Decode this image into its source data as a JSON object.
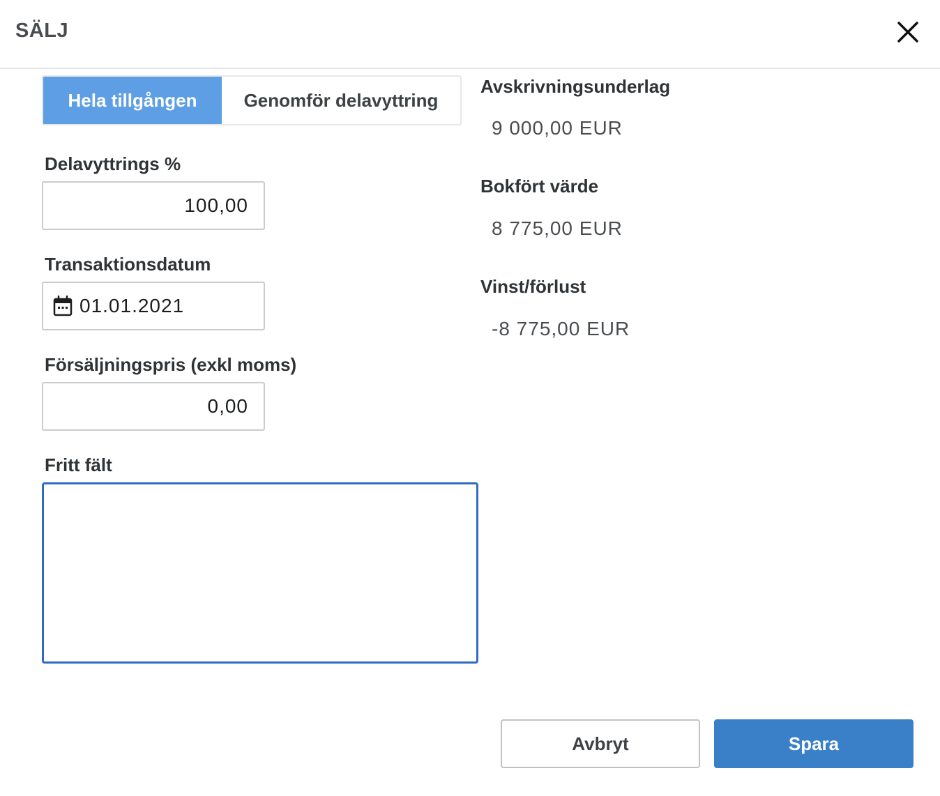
{
  "dialog": {
    "title": "SÄLJ",
    "close_icon": "close-icon"
  },
  "mode_toggle": {
    "options": [
      {
        "label": "Hela tillgången",
        "selected": true
      },
      {
        "label": "Genomför delavyttring",
        "selected": false
      }
    ],
    "active_color": "#5e9ee4"
  },
  "form": {
    "percent": {
      "label": "Delavyttrings %",
      "value": "100,00"
    },
    "date": {
      "label": "Transaktionsdatum",
      "value": "01.01.2021",
      "icon": "calendar-icon"
    },
    "price": {
      "label": "Försäljningspris (exkl moms)",
      "value": "0,00"
    },
    "free_text": {
      "label": "Fritt fält",
      "value": ""
    }
  },
  "summary": {
    "depreciation_base": {
      "label": "Avskrivningsunderlag",
      "value": "9 000,00 EUR"
    },
    "book_value": {
      "label": "Bokfört värde",
      "value": "8 775,00 EUR"
    },
    "profit_loss": {
      "label": "Vinst/förlust",
      "value": "-8 775,00 EUR"
    }
  },
  "actions": {
    "cancel_label": "Avbryt",
    "save_label": "Spara",
    "save_color": "#3a80c8"
  }
}
